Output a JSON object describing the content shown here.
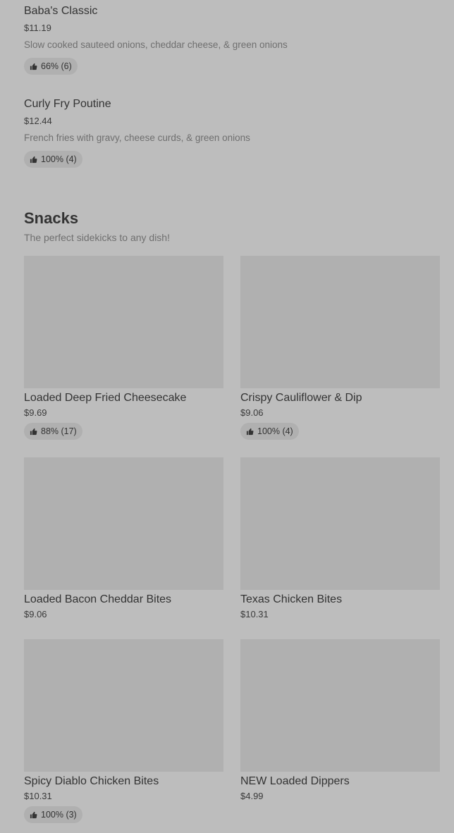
{
  "items": [
    {
      "name": "Baba's Classic",
      "price": "$11.19",
      "description": "Slow cooked sauteed onions, cheddar cheese, & green onions",
      "rating": "66% (6)"
    },
    {
      "name": "Curly Fry Poutine",
      "price": "$12.44",
      "description": "French fries with gravy, cheese curds, & green onions",
      "rating": "100% (4)"
    }
  ],
  "snacks": {
    "title": "Snacks",
    "subtitle": "The perfect sidekicks to any dish!",
    "cards": [
      {
        "name": "Loaded Deep Fried Cheesecake",
        "price": "$9.69",
        "rating": "88% (17)"
      },
      {
        "name": "Crispy Cauliflower & Dip",
        "price": "$9.06",
        "rating": "100% (4)"
      },
      {
        "name": "Loaded Bacon Cheddar Bites",
        "price": "$9.06"
      },
      {
        "name": "Texas Chicken Bites",
        "price": "$10.31"
      },
      {
        "name": "Spicy Diablo Chicken Bites",
        "price": "$10.31",
        "rating": "100% (3)"
      },
      {
        "name": "NEW Loaded Dippers",
        "price": "$4.99"
      }
    ]
  },
  "icons": {
    "rating": "thumbs-up-icon"
  },
  "colors": {
    "background": "#bdbdbd",
    "placeholder": "#b0b0b0",
    "text": "#333333",
    "muted": "#6f6f6f"
  }
}
